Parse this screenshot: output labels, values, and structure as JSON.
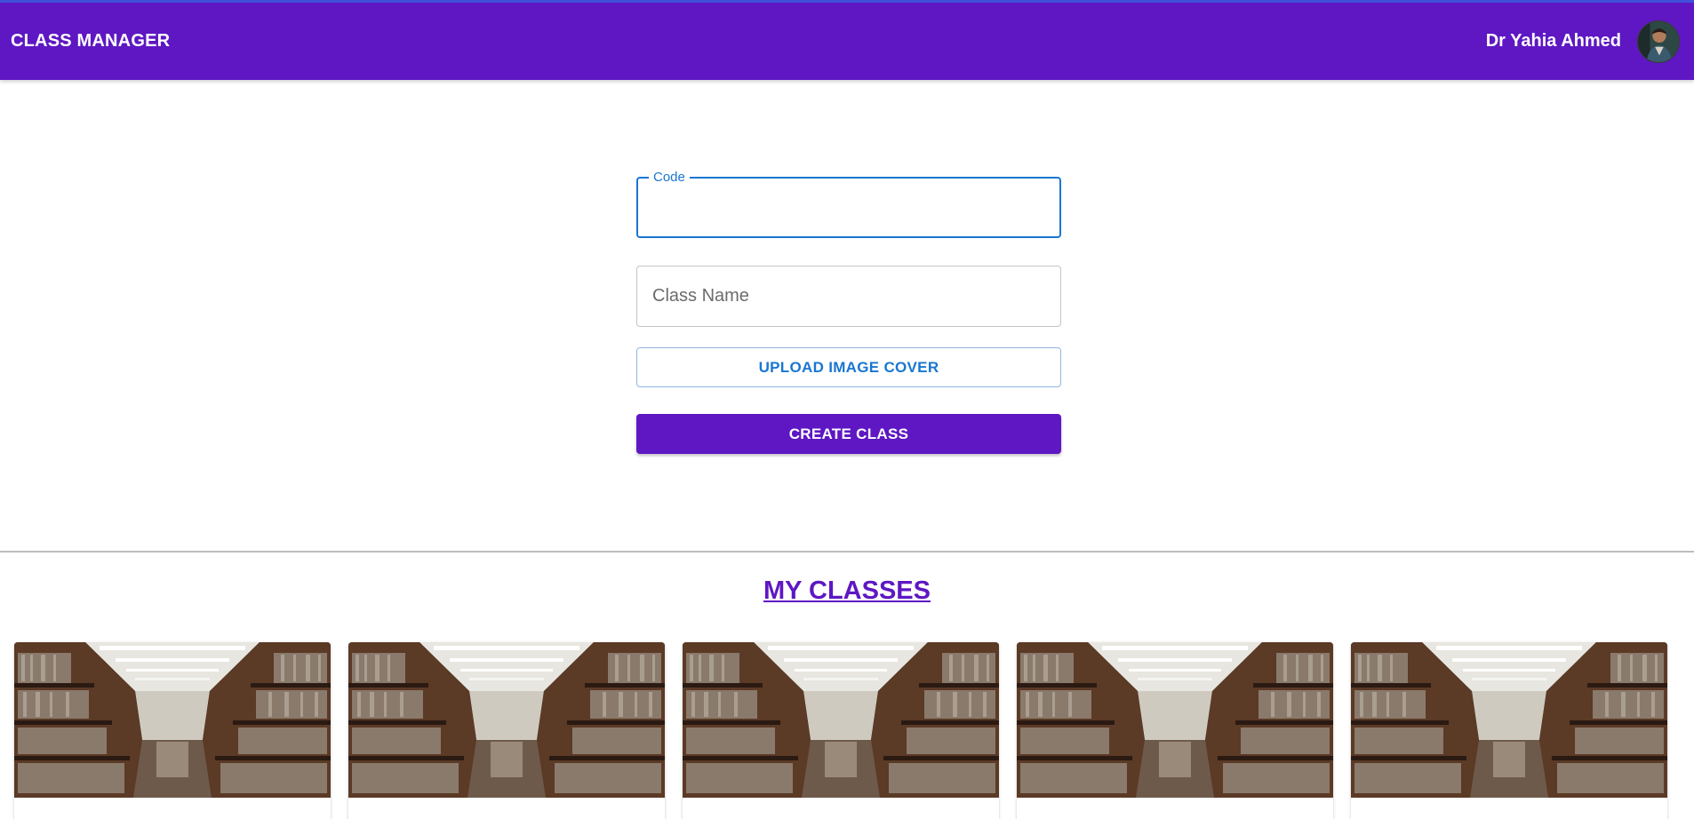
{
  "appbar": {
    "title": "CLASS MANAGER",
    "user_name": "Dr Yahia Ahmed",
    "avatar_icon": "user-avatar",
    "color": "#5e17c3"
  },
  "form": {
    "code": {
      "label": "Code",
      "value": ""
    },
    "class_name": {
      "placeholder": "Class Name",
      "value": ""
    },
    "upload_label": "UPLOAD IMAGE COVER",
    "create_label": "CREATE CLASS"
  },
  "classes": {
    "title": "MY CLASSES",
    "cards": [
      {
        "image": "library-bookshelves-image"
      },
      {
        "image": "library-bookshelves-image"
      },
      {
        "image": "library-bookshelves-image"
      },
      {
        "image": "library-bookshelves-image"
      },
      {
        "image": "library-bookshelves-image"
      }
    ]
  },
  "colors": {
    "primary": "#5e17c3",
    "focus_blue": "#1976d2"
  }
}
